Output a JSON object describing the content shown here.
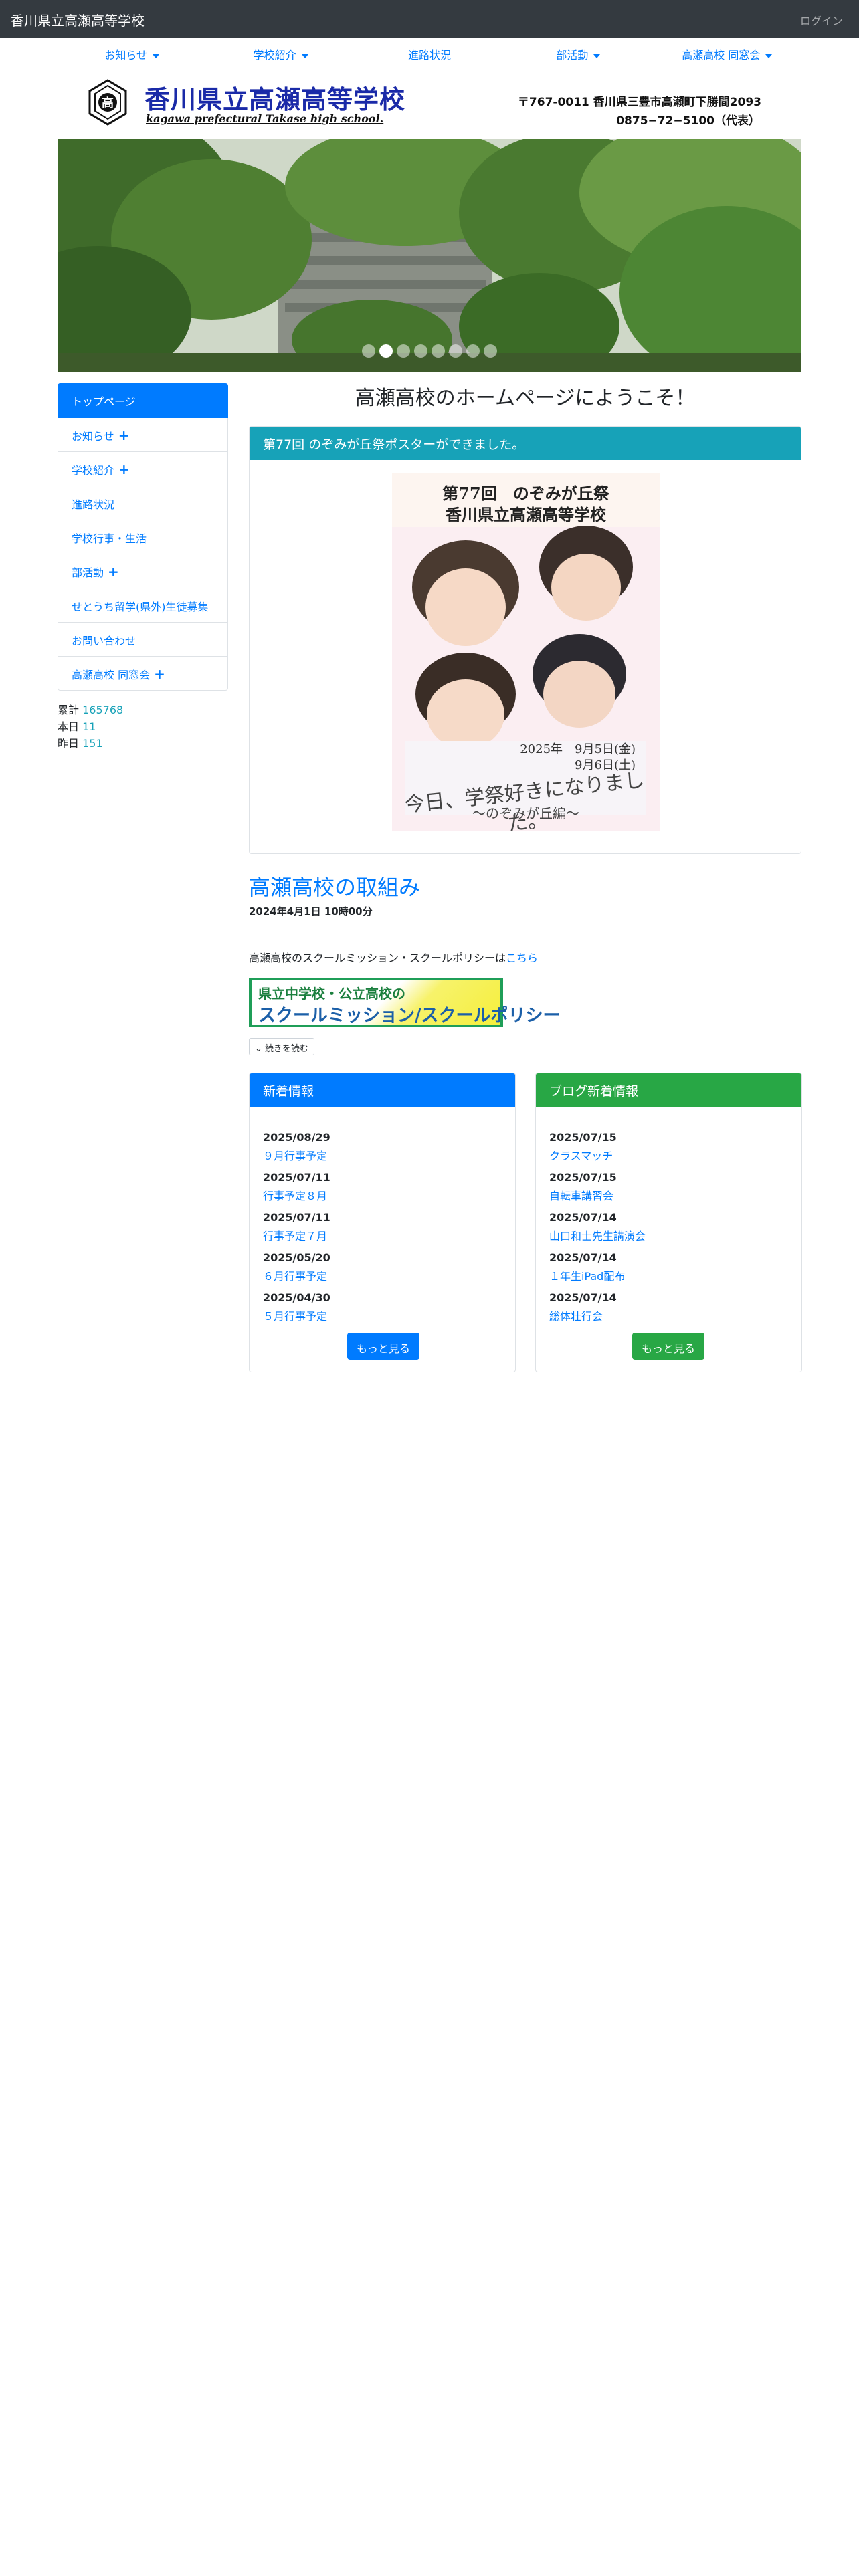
{
  "navbar": {
    "brand": "香川県立高瀬高等学校",
    "login": "ログイン"
  },
  "menu": [
    {
      "label": "お知らせ",
      "dropdown": true
    },
    {
      "label": "学校紹介",
      "dropdown": true
    },
    {
      "label": "進路状況",
      "dropdown": false
    },
    {
      "label": "部活動",
      "dropdown": true
    },
    {
      "label": "高瀬高校 同窓会",
      "dropdown": true
    }
  ],
  "header": {
    "emblem_char": "高",
    "school_name": "香川県立高瀬高等学校",
    "school_name_en": "kagawa prefectural Takase high school.",
    "address": "〒767-0011 香川県三豊市高瀬町下勝間2093",
    "phone": "0875−72−5100（代表）"
  },
  "carousel": {
    "slide_count": 8,
    "active_index": 1
  },
  "sidebar": {
    "items": [
      {
        "label": "トップページ",
        "expand": false,
        "active": true
      },
      {
        "label": "お知らせ",
        "expand": true,
        "active": false
      },
      {
        "label": "学校紹介",
        "expand": true,
        "active": false
      },
      {
        "label": "進路状況",
        "expand": false,
        "active": false
      },
      {
        "label": "学校行事・生活",
        "expand": false,
        "active": false
      },
      {
        "label": "部活動",
        "expand": true,
        "active": false
      },
      {
        "label": "せとうち留学(県外)生徒募集",
        "expand": false,
        "active": false
      },
      {
        "label": "お問い合わせ",
        "expand": false,
        "active": false
      },
      {
        "label": "高瀬高校 同窓会",
        "expand": true,
        "active": false
      }
    ],
    "counter": [
      {
        "label": "累計",
        "value": "165768"
      },
      {
        "label": "本日",
        "value": "11"
      },
      {
        "label": "昨日",
        "value": "151"
      }
    ]
  },
  "main": {
    "welcome": "高瀬高校のホームページにようこそ！",
    "poster_card": {
      "heading": "第77回 のぞみが丘祭ポスターができました。",
      "poster_title1": "第77回　のぞみが丘祭",
      "poster_title2": "香川県立高瀬高等学校",
      "poster_date1": "2025年　9月5日(金)",
      "poster_date2": "9月6日(土)",
      "poster_slogan": "今日、学祭好きになりました。",
      "poster_sub": "〜のぞみが丘編〜"
    },
    "article": {
      "title": "高瀬高校の取組み",
      "date": "2024年4月1日 10時00分",
      "text": "高瀬高校のスクールミッション・スクールポリシーは",
      "link": "こちら",
      "banner_line1": "県立中学校・公立高校の",
      "banner_line2": "スクールミッション/スクールポリシー",
      "read_more": "続きを読む"
    },
    "news": {
      "heading": "新着情報",
      "items": [
        {
          "date": "2025/08/29",
          "title": "９月行事予定"
        },
        {
          "date": "2025/07/11",
          "title": "行事予定８月"
        },
        {
          "date": "2025/07/11",
          "title": "行事予定７月"
        },
        {
          "date": "2025/05/20",
          "title": "６月行事予定"
        },
        {
          "date": "2025/04/30",
          "title": "５月行事予定"
        }
      ],
      "more": "もっと見る"
    },
    "blog": {
      "heading": "ブログ新着情報",
      "items": [
        {
          "date": "2025/07/15",
          "title": "クラスマッチ"
        },
        {
          "date": "2025/07/15",
          "title": "自転車講習会"
        },
        {
          "date": "2025/07/14",
          "title": "山口和士先生講演会"
        },
        {
          "date": "2025/07/14",
          "title": "１年生iPad配布"
        },
        {
          "date": "2025/07/14",
          "title": "総体壮行会"
        }
      ],
      "more": "もっと見る"
    }
  },
  "colors": {
    "navbar_bg": "#343a40",
    "primary": "#007bff",
    "info": "#17a2b8",
    "success": "#28a745",
    "school_name": "#1a2aa8"
  }
}
